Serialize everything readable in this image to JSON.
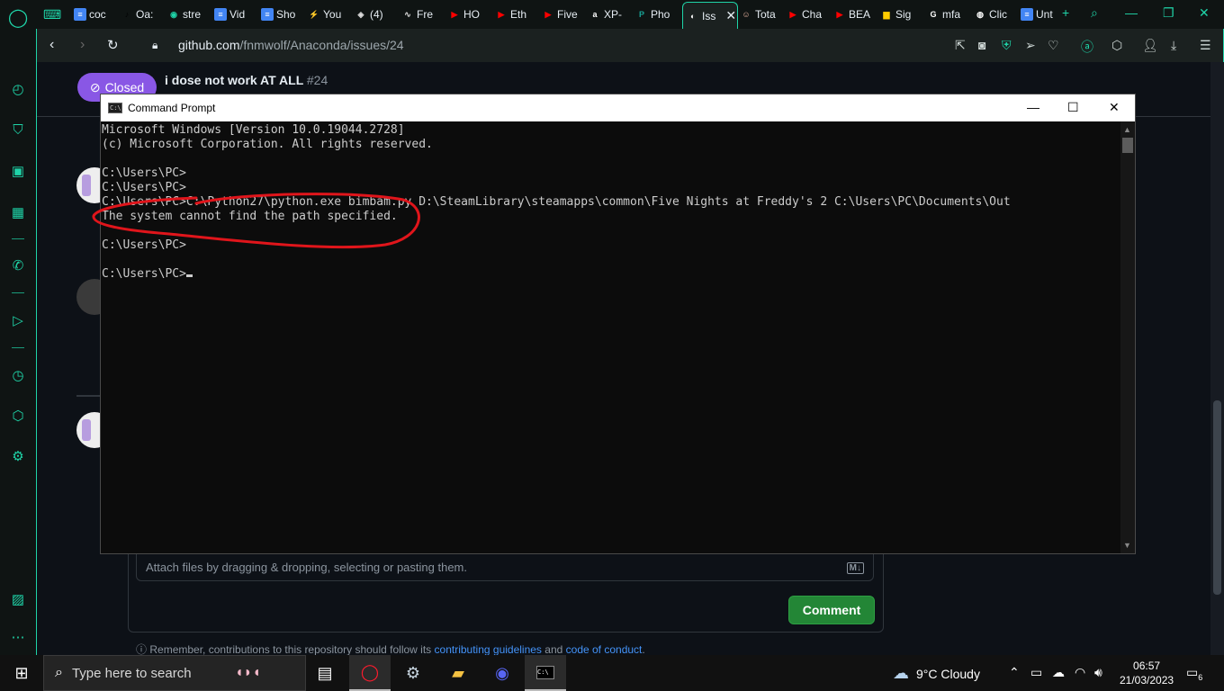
{
  "sidebar": {
    "items": [
      "opera-logo",
      "speed-dial",
      "shopping",
      "twitch",
      "news",
      "whatsapp",
      "player",
      "history",
      "cube",
      "settings",
      "gallery",
      "more"
    ]
  },
  "tabs": [
    {
      "label": "coc",
      "favicon": "doc",
      "color": "#4285f4"
    },
    {
      "label": "Oa:",
      "favicon": "tiktok",
      "color": "#000000"
    },
    {
      "label": "stre",
      "favicon": "stream",
      "color": "#1fd4a8"
    },
    {
      "label": "Vid",
      "favicon": "doc",
      "color": "#4285f4"
    },
    {
      "label": "Sho",
      "favicon": "doc",
      "color": "#4285f4"
    },
    {
      "label": "You",
      "favicon": "bolt",
      "color": "#dddddd"
    },
    {
      "label": "(4)",
      "favicon": "cube",
      "color": "#dddddd"
    },
    {
      "label": "Fre",
      "favicon": "wave",
      "color": "#dddddd"
    },
    {
      "label": "HO",
      "favicon": "youtube",
      "color": "#ff0000"
    },
    {
      "label": "Eth",
      "favicon": "youtube",
      "color": "#ff0000"
    },
    {
      "label": "Five",
      "favicon": "youtube",
      "color": "#ff0000"
    },
    {
      "label": "XP-",
      "favicon": "amazon",
      "color": "#ffffff"
    },
    {
      "label": "Pho",
      "favicon": "photopea",
      "color": "#18a497"
    },
    {
      "label": "Iss",
      "favicon": "github",
      "color": "#ffffff",
      "active": true
    },
    {
      "label": "Tota",
      "favicon": "face",
      "color": "#e8b4a0"
    },
    {
      "label": "Cha",
      "favicon": "youtube",
      "color": "#ff0000"
    },
    {
      "label": "BEA",
      "favicon": "youtube",
      "color": "#ff0000"
    },
    {
      "label": "Sig",
      "favicon": "flag",
      "color": "#ffcc00"
    },
    {
      "label": "mfa",
      "favicon": "google",
      "color": "#ffffff"
    },
    {
      "label": "Clic",
      "favicon": "globe",
      "color": "#ffffff"
    },
    {
      "label": "Unt",
      "favicon": "doc",
      "color": "#4285f4"
    }
  ],
  "address": {
    "host": "github.com",
    "path": "/fnmwolf/Anaconda/issues/24"
  },
  "issue": {
    "status": "Closed",
    "title": "i dose not work AT ALL",
    "number": "#24"
  },
  "comment_form": {
    "attach_text": "Attach files by dragging & dropping, selecting or pasting them.",
    "md_label": "M↓",
    "comment_button": "Comment",
    "remember_prefix": "Remember, contributions to this repository should follow its",
    "link1": "contributing guidelines",
    "and": "and",
    "link2": "code of conduct",
    "suffix": "."
  },
  "cmd": {
    "title": "Command Prompt",
    "lines": [
      "Microsoft Windows [Version 10.0.19044.2728]",
      "(c) Microsoft Corporation. All rights reserved.",
      "",
      "C:\\Users\\PC>",
      "C:\\Users\\PC>",
      "C:\\Users\\PC>C:\\Python27\\python.exe bimbam.py D:\\SteamLibrary\\steamapps\\common\\Five Nights at Freddy's 2 C:\\Users\\PC\\Documents\\Out",
      "The system cannot find the path specified.",
      "",
      "C:\\Users\\PC>",
      "",
      "C:\\Users\\PC>"
    ],
    "annotation_color": "#e0151b"
  },
  "taskbar": {
    "search_placeholder": "Type here to search",
    "weather": "9°C  Cloudy",
    "time": "06:57",
    "date": "21/03/2023",
    "notifications": "6"
  }
}
